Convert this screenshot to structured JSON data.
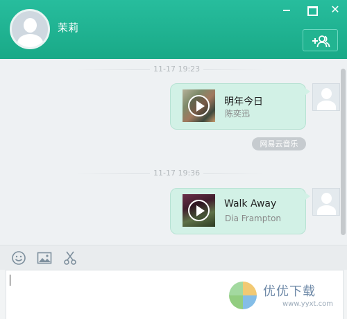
{
  "header": {
    "contact_name": "茉莉",
    "add_friend_icon": "add-people-icon",
    "controls": [
      "minimize-icon",
      "maximize-icon",
      "close-icon"
    ],
    "close_symbol": "✕"
  },
  "messages": [
    {
      "timestamp": "11-17 19:23",
      "song_title": "明年今日",
      "artist": "陈奕迅",
      "source_label": "网易云音乐"
    },
    {
      "timestamp": "11-17 19:36",
      "song_title": "Walk Away",
      "artist": "Dia Frampton"
    }
  ],
  "toolbar": {
    "icons": [
      "emoji-icon",
      "image-icon",
      "scissors-icon"
    ]
  },
  "input": {
    "value": ""
  },
  "watermark": {
    "text": "优优下载",
    "url": "www.yyxt.com"
  },
  "colors": {
    "header": "#1fb393",
    "bubble": "#d2f1e6",
    "chat_bg": "#eef1f3"
  }
}
